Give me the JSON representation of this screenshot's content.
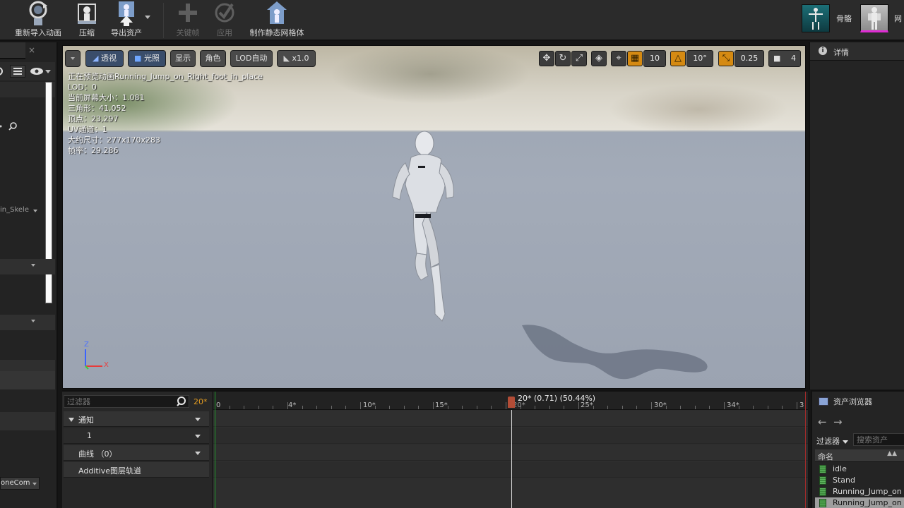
{
  "toolbar": {
    "reimport_label": "重新导入动画",
    "compress_label": "压缩",
    "export_label": "导出资产",
    "key_label": "关键帧",
    "apply_label": "应用",
    "make_static_mesh_label": "制作静态网格体",
    "skeleton_label": "骨骼",
    "mesh_label": "网"
  },
  "left_panel": {
    "skeleton_combo": "in_Skele",
    "bone_combo": "oneCom"
  },
  "viewport": {
    "perspective_label": "透视",
    "lighting_label": "光照",
    "show_label": "显示",
    "character_label": "角色",
    "lod_label": "LOD自动",
    "speed_label": "x1.0",
    "grid_snap_value": "10",
    "angle_snap_value": "10°",
    "scale_snap_value": "0.25",
    "camera_speed_value": "4",
    "info": {
      "preview": "正在预览动画Running_Jump_on_Right_foot_in_place",
      "lod": "LOD：0",
      "screen_size": "当前屏幕大小：1.081",
      "triangles": "三角形：41,052",
      "vertices": "顶点：23,297",
      "uv_channels": "UV通道：1",
      "approx_size": "大约尺寸：277x170x283",
      "frame_rate": "帧率：29.286"
    },
    "gizmo_z": "Z",
    "gizmo_x": "X"
  },
  "details": {
    "tab_label": "详情"
  },
  "sequence": {
    "filter_placeholder": "过滤器",
    "current_frame": "20*",
    "tracks": [
      {
        "label": "通知"
      },
      {
        "label": "1"
      },
      {
        "label": "曲线 （0）"
      },
      {
        "label": "Additive图层轨道"
      }
    ],
    "ruler_labels": [
      "0",
      "4*",
      "10*",
      "15*",
      "20*",
      "25*",
      "30*",
      "34*",
      "3"
    ],
    "playhead_label": "20* (0.71) (50.44%)"
  },
  "asset_browser": {
    "tab_label": "资产浏览器",
    "back_icon": "←",
    "forward_icon": "→",
    "filter_label": "过滤器",
    "search_placeholder": "搜索资产",
    "column_name": "命名",
    "assets": [
      {
        "name": "idle"
      },
      {
        "name": "Stand"
      },
      {
        "name": "Running_Jump_on"
      },
      {
        "name": "Running_Jump_on"
      }
    ]
  }
}
